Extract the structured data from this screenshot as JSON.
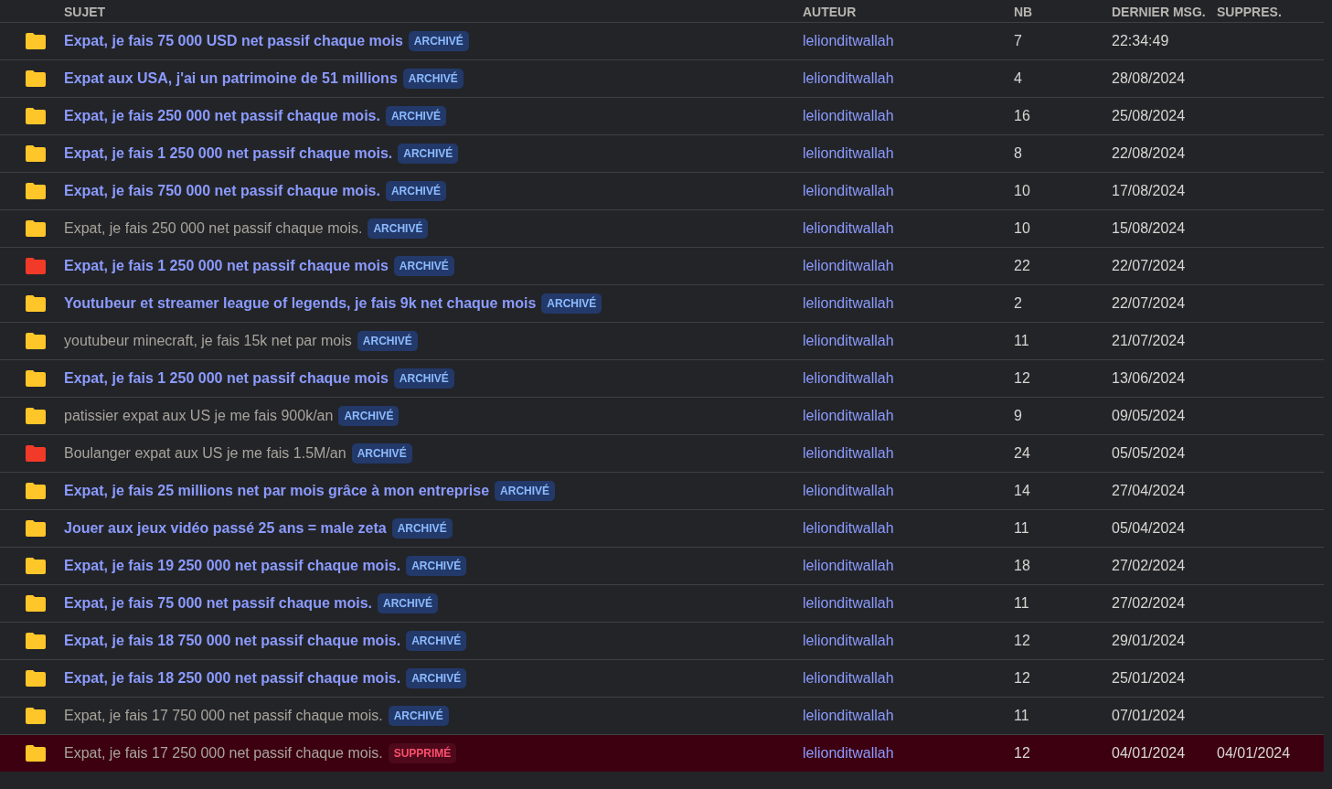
{
  "table": {
    "columns": [
      "SUJET",
      "AUTEUR",
      "NB",
      "DERNIER MSG.",
      "SUPPRES."
    ],
    "rows": [
      {
        "color": "#ffc629",
        "subject": "Expat, je fais 75 000 USD net passif chaque mois",
        "visited": false,
        "badge": {
          "kind": "archived",
          "label": "ARCHIVÉ"
        },
        "author": "lelionditwallah",
        "count": "7",
        "last_message": "22:34:49",
        "deleted": false
      },
      {
        "color": "#ffc629",
        "subject": "Expat aux USA, j'ai un patrimoine de 51 millions",
        "visited": false,
        "badge": {
          "kind": "archived",
          "label": "ARCHIVÉ"
        },
        "author": "lelionditwallah",
        "count": "4",
        "last_message": "28/08/2024",
        "deleted": false
      },
      {
        "color": "#ffc629",
        "subject": "Expat, je fais 250 000 net passif chaque mois.",
        "visited": false,
        "badge": {
          "kind": "archived",
          "label": "ARCHIVÉ"
        },
        "author": "lelionditwallah",
        "count": "16",
        "last_message": "25/08/2024",
        "deleted": false
      },
      {
        "color": "#ffc629",
        "subject": "Expat, je fais 1 250 000 net passif chaque mois.",
        "visited": false,
        "badge": {
          "kind": "archived",
          "label": "ARCHIVÉ"
        },
        "author": "lelionditwallah",
        "count": "8",
        "last_message": "22/08/2024",
        "deleted": false
      },
      {
        "color": "#ffc629",
        "subject": "Expat, je fais 750 000 net passif chaque mois.",
        "visited": false,
        "badge": {
          "kind": "archived",
          "label": "ARCHIVÉ"
        },
        "author": "lelionditwallah",
        "count": "10",
        "last_message": "17/08/2024",
        "deleted": false
      },
      {
        "color": "#ffc629",
        "subject": "Expat, je fais 250 000 net passif chaque mois.",
        "visited": true,
        "badge": {
          "kind": "archived",
          "label": "ARCHIVÉ"
        },
        "author": "lelionditwallah",
        "count": "10",
        "last_message": "15/08/2024",
        "deleted": false
      },
      {
        "color": "#f23a28",
        "subject": "Expat, je fais 1 250 000 net passif chaque mois",
        "visited": false,
        "badge": {
          "kind": "archived",
          "label": "ARCHIVÉ"
        },
        "author": "lelionditwallah",
        "count": "22",
        "last_message": "22/07/2024",
        "deleted": false
      },
      {
        "color": "#ffc629",
        "subject": "Youtubeur et streamer league of legends, je fais 9k net chaque mois",
        "visited": false,
        "badge": {
          "kind": "archived",
          "label": "ARCHIVÉ"
        },
        "author": "lelionditwallah",
        "count": "2",
        "last_message": "22/07/2024",
        "deleted": false
      },
      {
        "color": "#ffc629",
        "subject": "youtubeur minecraft, je fais 15k net par mois",
        "visited": true,
        "badge": {
          "kind": "archived",
          "label": "ARCHIVÉ"
        },
        "author": "lelionditwallah",
        "count": "11",
        "last_message": "21/07/2024",
        "deleted": false
      },
      {
        "color": "#ffc629",
        "subject": "Expat, je fais 1 250 000 net passif chaque mois",
        "visited": false,
        "badge": {
          "kind": "archived",
          "label": "ARCHIVÉ"
        },
        "author": "lelionditwallah",
        "count": "12",
        "last_message": "13/06/2024",
        "deleted": false
      },
      {
        "color": "#ffc629",
        "subject": "patissier expat aux US je me fais 900k/an",
        "visited": true,
        "badge": {
          "kind": "archived",
          "label": "ARCHIVÉ"
        },
        "author": "lelionditwallah",
        "count": "9",
        "last_message": "09/05/2024",
        "deleted": false
      },
      {
        "color": "#f23a28",
        "subject": "Boulanger expat aux US je me fais 1.5M/an",
        "visited": true,
        "badge": {
          "kind": "archived",
          "label": "ARCHIVÉ"
        },
        "author": "lelionditwallah",
        "count": "24",
        "last_message": "05/05/2024",
        "deleted": false
      },
      {
        "color": "#ffc629",
        "subject": "Expat, je fais 25 millions net par mois grâce à mon entreprise",
        "visited": false,
        "badge": {
          "kind": "archived",
          "label": "ARCHIVÉ"
        },
        "author": "lelionditwallah",
        "count": "14",
        "last_message": "27/04/2024",
        "deleted": false
      },
      {
        "color": "#ffc629",
        "subject": "Jouer aux jeux vidéo passé 25 ans = male zeta",
        "visited": false,
        "badge": {
          "kind": "archived",
          "label": "ARCHIVÉ"
        },
        "author": "lelionditwallah",
        "count": "11",
        "last_message": "05/04/2024",
        "deleted": false
      },
      {
        "color": "#ffc629",
        "subject": "Expat, je fais 19 250 000 net passif chaque mois.",
        "visited": false,
        "badge": {
          "kind": "archived",
          "label": "ARCHIVÉ"
        },
        "author": "lelionditwallah",
        "count": "18",
        "last_message": "27/02/2024",
        "deleted": false
      },
      {
        "color": "#ffc629",
        "subject": "Expat, je fais 75 000 net passif chaque mois.",
        "visited": false,
        "badge": {
          "kind": "archived",
          "label": "ARCHIVÉ"
        },
        "author": "lelionditwallah",
        "count": "11",
        "last_message": "27/02/2024",
        "deleted": false
      },
      {
        "color": "#ffc629",
        "subject": "Expat, je fais 18 750 000 net passif chaque mois.",
        "visited": false,
        "badge": {
          "kind": "archived",
          "label": "ARCHIVÉ"
        },
        "author": "lelionditwallah",
        "count": "12",
        "last_message": "29/01/2024",
        "deleted": false
      },
      {
        "color": "#ffc629",
        "subject": "Expat, je fais 18 250 000 net passif chaque mois.",
        "visited": false,
        "badge": {
          "kind": "archived",
          "label": "ARCHIVÉ"
        },
        "author": "lelionditwallah",
        "count": "12",
        "last_message": "25/01/2024",
        "deleted": false
      },
      {
        "color": "#ffc629",
        "subject": "Expat, je fais 17 750 000 net passif chaque mois.",
        "visited": true,
        "badge": {
          "kind": "archived",
          "label": "ARCHIVÉ"
        },
        "author": "lelionditwallah",
        "count": "11",
        "last_message": "07/01/2024",
        "deleted": false
      },
      {
        "color": "#ffc629",
        "subject": "Expat, je fais 17 250 000 net passif chaque mois.",
        "visited": true,
        "badge": {
          "kind": "deleted",
          "label": "SUPPRIMÉ"
        },
        "author": "lelionditwallah",
        "count": "12",
        "last_message": "04/01/2024",
        "deleted": true,
        "deleted_date": "04/01/2024"
      }
    ]
  }
}
